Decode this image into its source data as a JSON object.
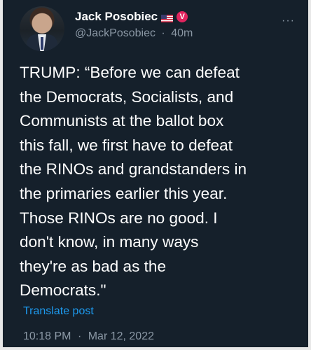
{
  "tweet": {
    "author": {
      "display_name": "Jack Posobiec",
      "handle": "@JackPosobiec",
      "flag_icon": "us-flag-icon",
      "badge_icon": "v-badge-icon",
      "badge_label": "V",
      "badge_color": "#e0245e"
    },
    "separator": "·",
    "relative_time": "40m",
    "text": "TRUMP: “Before we can defeat\nthe Democrats, Socialists, and\nCommunists at the ballot box\nthis fall, we first have to defeat\nthe RINOs and grandstanders in\nthe primaries earlier this year.\nThose RINOs are no good. I\ndon't know, in many ways\nthey're as bad as the\nDemocrats.\"",
    "translate_label": "Translate post",
    "time": "10:18 PM",
    "date": "Mar 12, 2022"
  },
  "colors": {
    "background": "#15202b",
    "text": "#ffffff",
    "muted": "#8b98a5",
    "link": "#1d9bf0"
  }
}
